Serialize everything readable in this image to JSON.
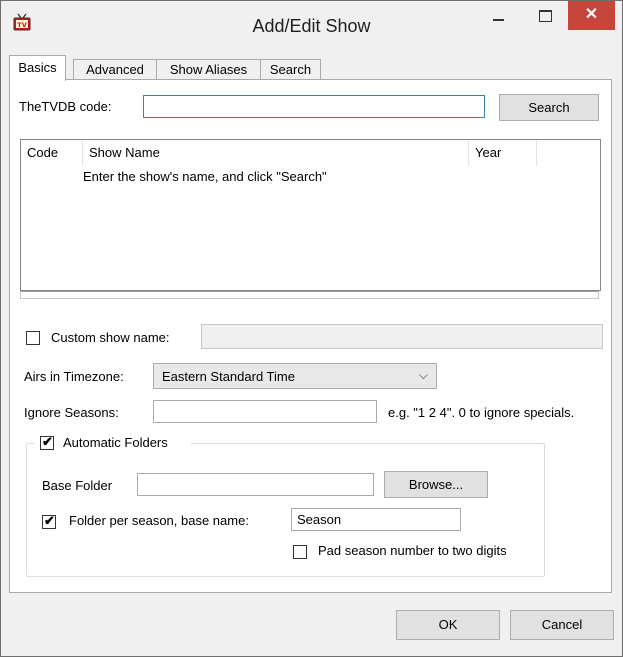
{
  "window": {
    "title": "Add/Edit Show",
    "app_icon": "tv-icon",
    "close_glyph": "✕"
  },
  "tabs": [
    {
      "label": "Basics",
      "active": true
    },
    {
      "label": "Advanced",
      "active": false
    },
    {
      "label": "Show Aliases",
      "active": false
    },
    {
      "label": "Search",
      "active": false
    }
  ],
  "basics": {
    "tvdb_label": "TheTVDB code:",
    "tvdb_value": "",
    "search_button": "Search",
    "columns": [
      "Code",
      "Show Name",
      "Year"
    ],
    "empty_hint": "Enter the show's name, and click \"Search\"",
    "custom_name_label": "Custom show name:",
    "custom_name_checked": false,
    "custom_name_value": "",
    "timezone_label": "Airs in Timezone:",
    "timezone_value": "Eastern Standard Time",
    "ignore_label": "Ignore Seasons:",
    "ignore_value": "",
    "ignore_hint": "e.g. \"1 2 4\". 0 to ignore specials.",
    "auto_folders_label": "Automatic Folders",
    "auto_folders_checked": true,
    "base_folder_label": "Base Folder",
    "base_folder_value": "",
    "browse_button": "Browse...",
    "folder_per_season_label": "Folder per season, base name:",
    "folder_per_season_checked": true,
    "season_base_name": "Season",
    "pad_label": "Pad season number to two digits",
    "pad_checked": false,
    "check_glyph": "✔"
  },
  "footer": {
    "ok": "OK",
    "cancel": "Cancel"
  }
}
